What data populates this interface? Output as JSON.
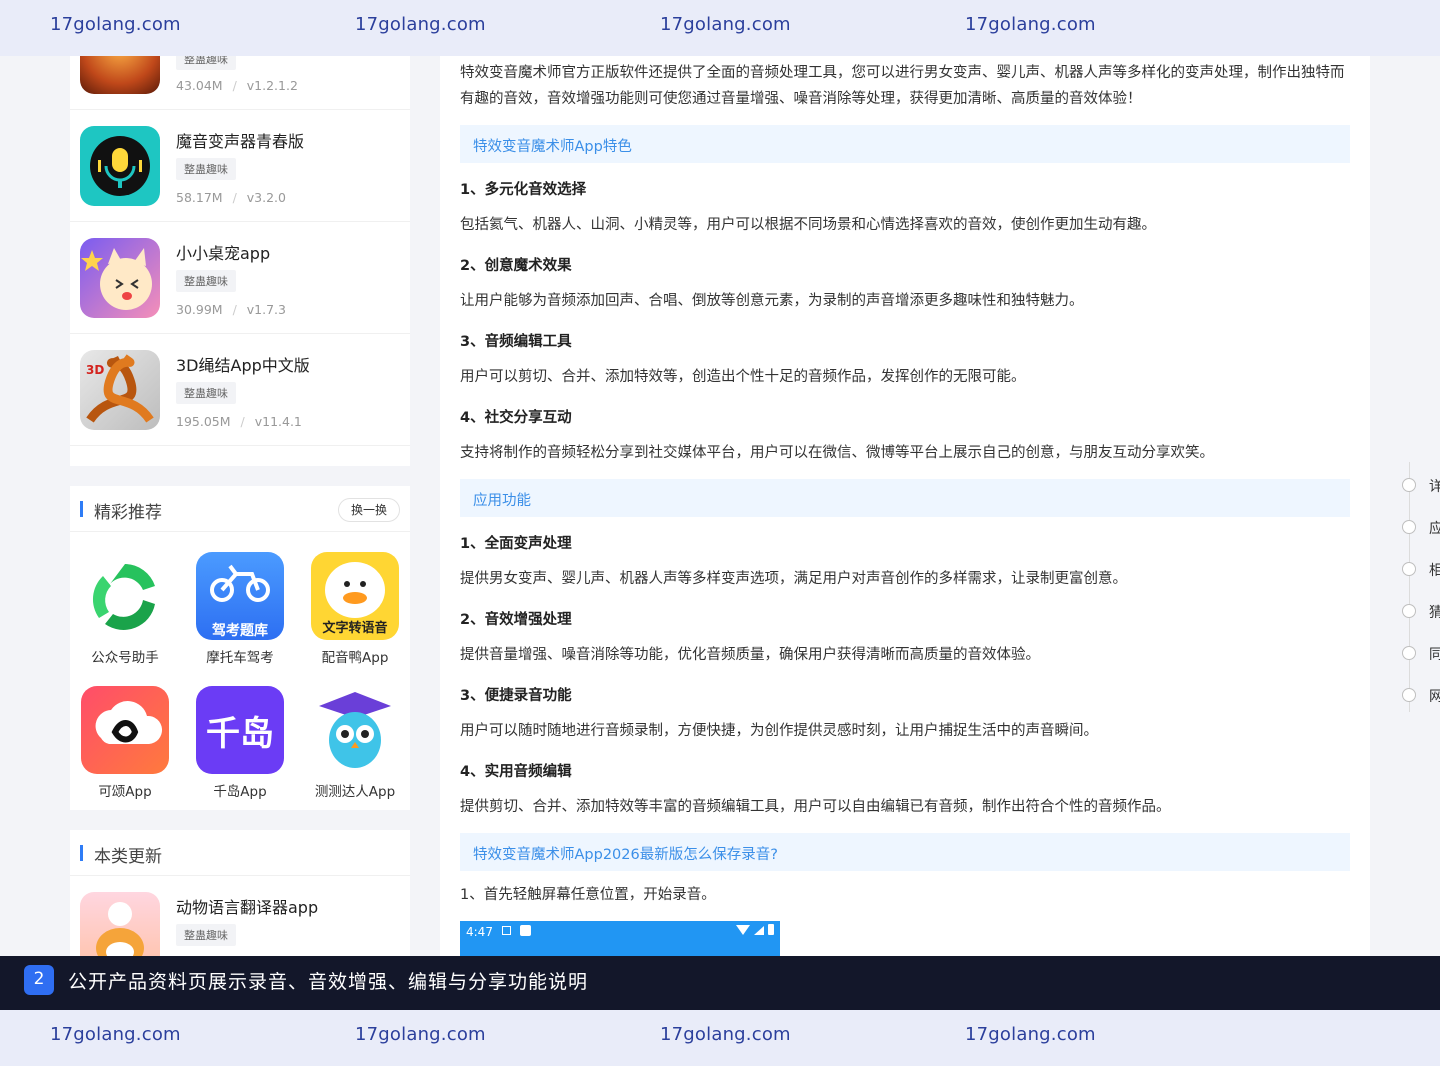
{
  "watermark": {
    "text": "17golang.com"
  },
  "app_list": {
    "top_partial": {
      "tag": "整蛊趣味",
      "size": "43.04M",
      "version": "v1.2.1.2"
    },
    "items": [
      {
        "name": "魔音变声器青春版",
        "tag": "整蛊趣味",
        "size": "58.17M",
        "version": "v3.2.0"
      },
      {
        "name": "小小桌宠app",
        "tag": "整蛊趣味",
        "size": "30.99M",
        "version": "v1.7.3"
      },
      {
        "name": "3D绳结App中文版",
        "tag": "整蛊趣味",
        "size": "195.05M",
        "version": "v11.4.1"
      }
    ],
    "separator": "/"
  },
  "featured": {
    "title": "精彩推荐",
    "refresh_label": "换一换",
    "apps": [
      {
        "label": "公众号助手",
        "icon_text": ""
      },
      {
        "label": "摩托车驾考",
        "icon_text": "驾考题库"
      },
      {
        "label": "配音鸭App",
        "icon_text": "文字转语音"
      },
      {
        "label": "可颂App",
        "icon_text": ""
      },
      {
        "label": "千岛App",
        "icon_text": "千岛"
      },
      {
        "label": "测测达人App",
        "icon_text": ""
      }
    ]
  },
  "updates": {
    "title": "本类更新",
    "items": [
      {
        "name": "动物语言翻译器app",
        "tag": "整蛊趣味"
      }
    ]
  },
  "article": {
    "intro": "特效变音魔术师官方正版软件还提供了全面的音频处理工具，您可以进行男女变声、婴儿声、机器人声等多样化的变声处理，制作出独特而有趣的音效，音效增强功能则可使您通过音量增强、噪音消除等处理，获得更加清晰、高质量的音效体验！",
    "section1_title": "特效变音魔术师App特色",
    "section1_items": [
      {
        "title": "1、多元化音效选择",
        "text": "包括氦气、机器人、山洞、小精灵等，用户可以根据不同场景和心情选择喜欢的音效，使创作更加生动有趣。"
      },
      {
        "title": "2、创意魔术效果",
        "text": "让用户能够为音频添加回声、合唱、倒放等创意元素，为录制的声音增添更多趣味性和独特魅力。"
      },
      {
        "title": "3、音频编辑工具",
        "text": "用户可以剪切、合并、添加特效等，创造出个性十足的音频作品，发挥创作的无限可能。"
      },
      {
        "title": "4、社交分享互动",
        "text": "支持将制作的音频轻松分享到社交媒体平台，用户可以在微信、微博等平台上展示自己的创意，与朋友互动分享欢笑。"
      }
    ],
    "section2_title": "应用功能",
    "section2_items": [
      {
        "title": "1、全面变声处理",
        "text": "提供男女变声、婴儿声、机器人声等多样变声选项，满足用户对声音创作的多样需求，让录制更富创意。"
      },
      {
        "title": "2、音效增强处理",
        "text": "提供音量增强、噪音消除等功能，优化音频质量，确保用户获得清晰而高质量的音效体验。"
      },
      {
        "title": "3、便捷录音功能",
        "text": "用户可以随时随地进行音频录制，方便快捷，为创作提供灵感时刻，让用户捕捉生活中的声音瞬间。"
      },
      {
        "title": "4、实用音频编辑",
        "text": "提供剪切、合并、添加特效等丰富的音频编辑工具，用户可以自由编辑已有音频，制作出符合个性的音频作品。"
      }
    ],
    "section3_title": "特效变音魔术师App2026最新版怎么保存录音?",
    "step1": "1、首先轻触屏幕任意位置，开始录音。",
    "phone_time": "4:47"
  },
  "toc": {
    "items": [
      "详",
      "应",
      "相",
      "猜",
      "同",
      "网"
    ]
  },
  "caption": {
    "number": "2",
    "text": "公开产品资料页展示录音、音效增强、编辑与分享功能说明"
  },
  "colors": {
    "accent": "#2e7cf6",
    "link_blue": "#3b8fe8",
    "watermark_bar": "#e9ecf9",
    "caption_bar": "#13172a"
  }
}
